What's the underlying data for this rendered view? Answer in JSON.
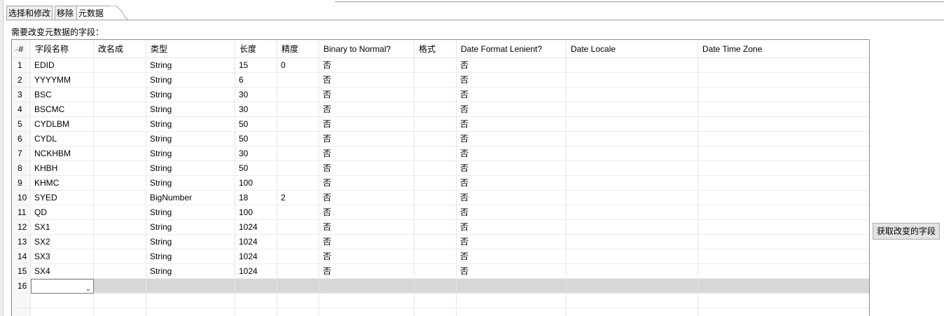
{
  "tabs": [
    {
      "label": "选择和修改",
      "active": false
    },
    {
      "label": "移除",
      "active": false
    },
    {
      "label": "元数据",
      "active": true
    }
  ],
  "fields_label": "需要改变元数据的字段：",
  "table": {
    "columns": [
      "#",
      "字段名称",
      "改名成",
      "类型",
      "长度",
      "精度",
      "Binary to Normal?",
      "格式",
      "Date Format Lenient?",
      "Date Locale",
      "Date Time Zone"
    ],
    "rows": [
      [
        "1",
        "EDID",
        "",
        "String",
        "15",
        "0",
        "否",
        "",
        "否",
        "",
        ""
      ],
      [
        "2",
        "YYYYMM",
        "",
        "String",
        "6",
        "",
        "否",
        "",
        "否",
        "",
        ""
      ],
      [
        "3",
        "BSC",
        "",
        "String",
        "30",
        "",
        "否",
        "",
        "否",
        "",
        ""
      ],
      [
        "4",
        "BSCMC",
        "",
        "String",
        "30",
        "",
        "否",
        "",
        "否",
        "",
        ""
      ],
      [
        "5",
        "CYDLBM",
        "",
        "String",
        "50",
        "",
        "否",
        "",
        "否",
        "",
        ""
      ],
      [
        "6",
        "CYDL",
        "",
        "String",
        "50",
        "",
        "否",
        "",
        "否",
        "",
        ""
      ],
      [
        "7",
        "NCKHBM",
        "",
        "String",
        "30",
        "",
        "否",
        "",
        "否",
        "",
        ""
      ],
      [
        "8",
        "KHBH",
        "",
        "String",
        "50",
        "",
        "否",
        "",
        "否",
        "",
        ""
      ],
      [
        "9",
        "KHMC",
        "",
        "String",
        "100",
        "",
        "否",
        "",
        "否",
        "",
        ""
      ],
      [
        "10",
        "SYED",
        "",
        "BigNumber",
        "18",
        "2",
        "否",
        "",
        "否",
        "",
        ""
      ],
      [
        "11",
        "QD",
        "",
        "String",
        "100",
        "",
        "否",
        "",
        "否",
        "",
        ""
      ],
      [
        "12",
        "SX1",
        "",
        "String",
        "1024",
        "",
        "否",
        "",
        "否",
        "",
        ""
      ],
      [
        "13",
        "SX2",
        "",
        "String",
        "1024",
        "",
        "否",
        "",
        "否",
        "",
        ""
      ],
      [
        "14",
        "SX3",
        "",
        "String",
        "1024",
        "",
        "否",
        "",
        "否",
        "",
        ""
      ],
      [
        "15",
        "SX4",
        "",
        "String",
        "1024",
        "",
        "否",
        "",
        "否",
        "",
        ""
      ]
    ],
    "new_row_index": "16",
    "new_row_value": ""
  },
  "get_fields_button": "获取改变的字段",
  "icons": {
    "sort": "sort-up-icon",
    "dropdown": "chevron-down-icon"
  }
}
